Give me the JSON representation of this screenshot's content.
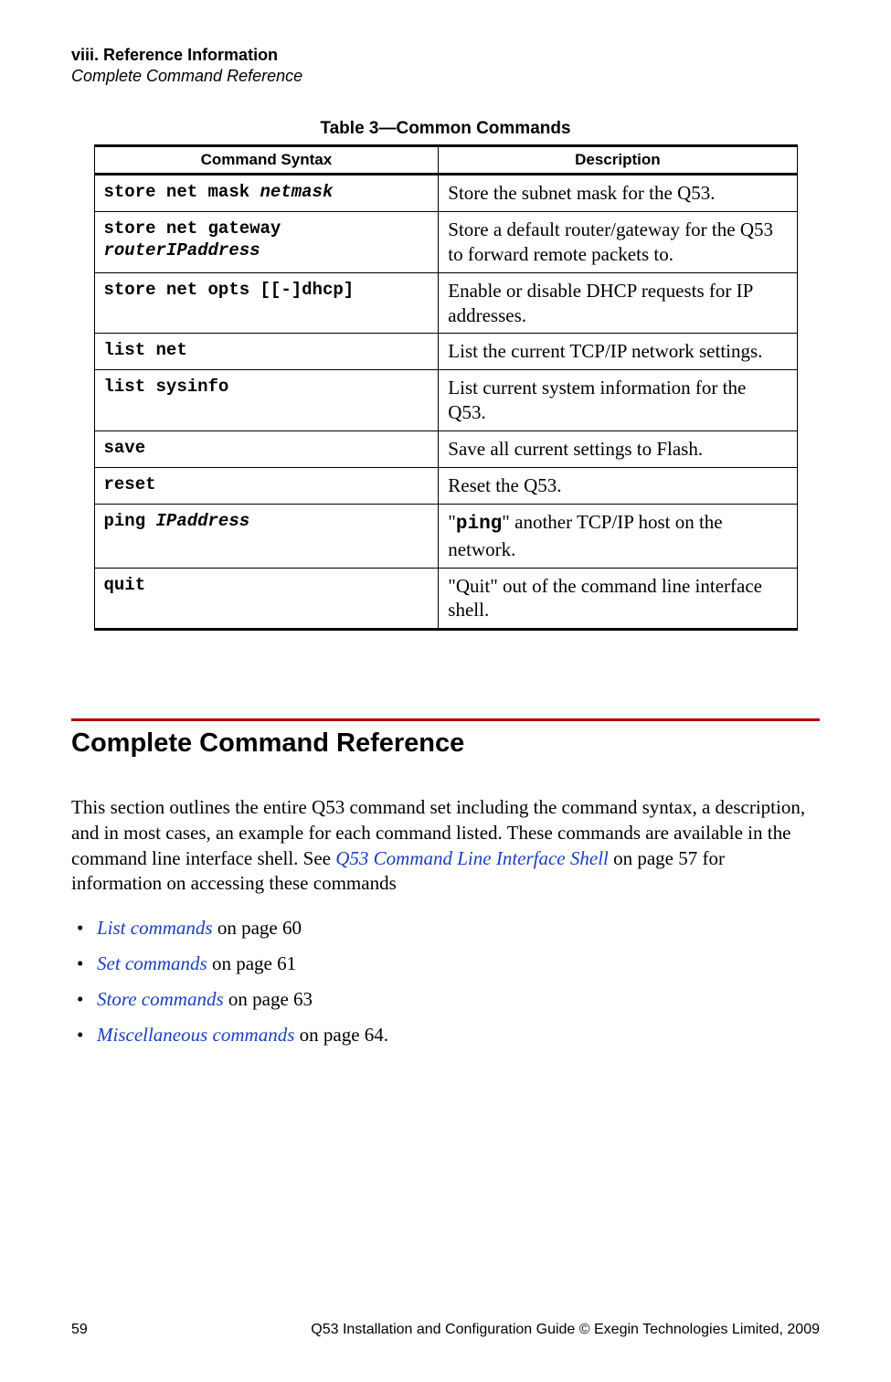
{
  "header": {
    "chapter": "viii. Reference Information",
    "section": "Complete Command Reference"
  },
  "table": {
    "title": "Table 3—Common Commands",
    "head": {
      "syntax": "Command Syntax",
      "desc": "Description"
    },
    "rows": [
      {
        "cmd": "store net mask ",
        "arg": "netmask",
        "desc": "Store the subnet mask for the Q53."
      },
      {
        "cmd": "store net gateway ",
        "arg": "routerIPaddress",
        "desc": "Store a default router/gateway for the Q53 to forward remote packets to."
      },
      {
        "cmd": "store net opts [[-]dhcp]",
        "arg": "",
        "desc": "Enable or disable DHCP requests for IP addresses."
      },
      {
        "cmd": "list net",
        "arg": "",
        "desc": "List the current TCP/IP network settings."
      },
      {
        "cmd": "list sysinfo",
        "arg": "",
        "desc": "List current system information for the Q53."
      },
      {
        "cmd": "save",
        "arg": "",
        "desc": "Save all current settings to Flash."
      },
      {
        "cmd": "reset",
        "arg": "",
        "desc": "Reset the Q53."
      },
      {
        "cmd": "ping ",
        "arg": "IPaddress",
        "desc_pre": "\"",
        "desc_code": "ping",
        "desc_post": "\" another TCP/IP host on the network."
      },
      {
        "cmd": "quit",
        "arg": "",
        "desc": "\"Quit\" out of the command line interface shell."
      }
    ]
  },
  "section_title": "Complete Command Reference",
  "intro": {
    "part1": "This section outlines the entire Q53 command set including the command syntax, a description, and in most cases, an example for each command listed. These commands are available in the command line interface shell. See ",
    "link": "Q53 Command Line Interface Shell",
    "part2": " on page 57 for information on accessing these commands"
  },
  "links": [
    {
      "text": "List commands",
      "suffix": " on page 60"
    },
    {
      "text": "Set commands",
      "suffix": " on page 61"
    },
    {
      "text": "Store commands",
      "suffix": " on page 63"
    },
    {
      "text": "Miscellaneous commands",
      "suffix": " on page 64."
    }
  ],
  "footer": {
    "page": "59",
    "info": "Q53 Installation and Configuration Guide  © Exegin Technologies Limited, 2009"
  }
}
